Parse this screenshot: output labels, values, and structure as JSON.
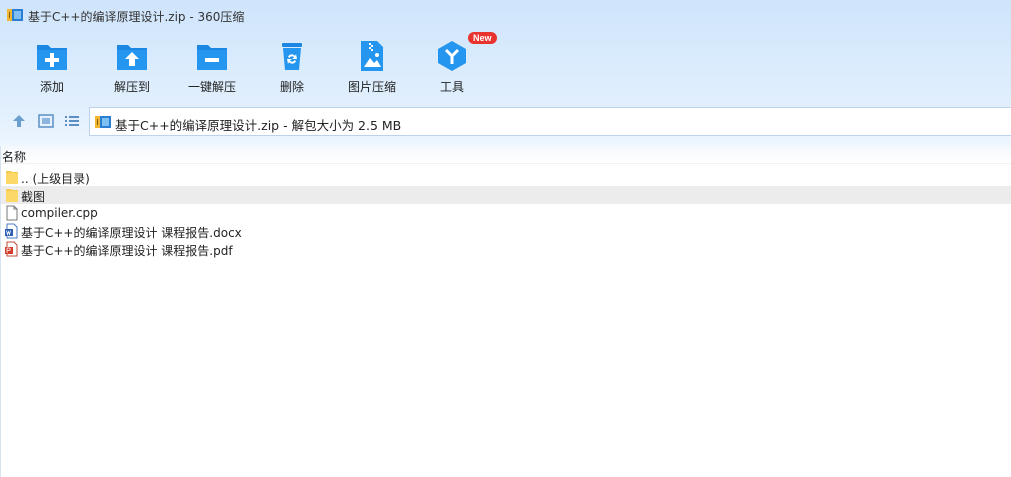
{
  "window": {
    "title": "基于C++的编译原理设计.zip - 360压缩"
  },
  "toolbar": {
    "items": [
      {
        "label": "添加",
        "icon": "add-folder-icon"
      },
      {
        "label": "解压到",
        "icon": "extract-to-icon"
      },
      {
        "label": "一键解压",
        "icon": "one-click-extract-icon"
      },
      {
        "label": "删除",
        "icon": "trash-icon"
      },
      {
        "label": "图片压缩",
        "icon": "image-compress-icon"
      },
      {
        "label": "工具",
        "icon": "tools-icon",
        "badge": "New"
      }
    ]
  },
  "nav": {
    "path_text": "基于C++的编译原理设计.zip - 解包大小为 2.5 MB"
  },
  "list": {
    "column_name": "名称",
    "rows": [
      {
        "name": ".. (上级目录)",
        "icon": "folder-icon",
        "selected": false
      },
      {
        "name": "截图",
        "icon": "folder-icon",
        "selected": true
      },
      {
        "name": "compiler.cpp",
        "icon": "file-icon",
        "selected": false
      },
      {
        "name": "基于C++的编译原理设计 课程报告.docx",
        "icon": "word-doc-icon",
        "selected": false
      },
      {
        "name": "基于C++的编译原理设计 课程报告.pdf",
        "icon": "pdf-icon",
        "selected": false
      }
    ]
  },
  "colors": {
    "accent": "#1e90e8",
    "badge": "#e8332e"
  }
}
